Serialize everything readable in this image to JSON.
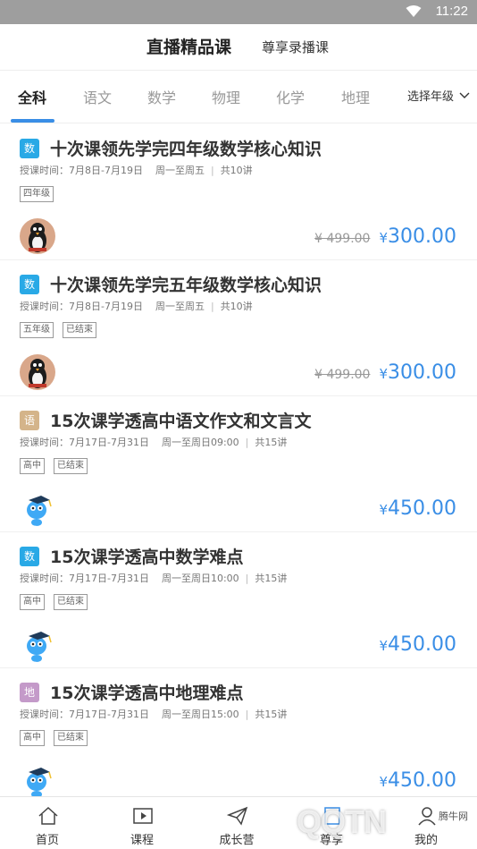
{
  "status": {
    "time": "11:22"
  },
  "header": {
    "title_live": "直播精品课",
    "title_recorded": "尊享录播课"
  },
  "tabs": {
    "items": [
      "全科",
      "语文",
      "数学",
      "物理",
      "化学",
      "地理"
    ],
    "active_index": 0,
    "grade_select_label": "选择年级"
  },
  "courses": [
    {
      "subject": "数",
      "subject_color": "#29a9e6",
      "title": "十次课领先学完四年级数学核心知识",
      "time": "授课时间：7月8日-7月19日",
      "days": "周一至周五",
      "count": "共10讲",
      "tags": [
        "四年级"
      ],
      "old_price": "¥ 499.00",
      "price_symbol": "¥",
      "price": "300.00",
      "avatar": "penguin-avatar"
    },
    {
      "subject": "数",
      "subject_color": "#29a9e6",
      "title": "十次课领先学完五年级数学核心知识",
      "time": "授课时间：7月8日-7月19日",
      "days": "周一至周五",
      "count": "共10讲",
      "tags": [
        "五年级",
        "已结束"
      ],
      "old_price": "¥ 499.00",
      "price_symbol": "¥",
      "price": "300.00",
      "avatar": "penguin-avatar"
    },
    {
      "subject": "语",
      "subject_color": "#d4b48a",
      "title": "15次课学透高中语文作文和文言文",
      "time": "授课时间：7月17日-7月31日",
      "days": "周一至周日09:00",
      "count": "共15讲",
      "tags": [
        "高中",
        "已结束"
      ],
      "old_price": "",
      "price_symbol": "¥",
      "price": "450.00",
      "avatar": "mascot-avatar"
    },
    {
      "subject": "数",
      "subject_color": "#29a9e6",
      "title": "15次课学透高中数学难点",
      "time": "授课时间：7月17日-7月31日",
      "days": "周一至周日10:00",
      "count": "共15讲",
      "tags": [
        "高中",
        "已结束"
      ],
      "old_price": "",
      "price_symbol": "¥",
      "price": "450.00",
      "avatar": "mascot-avatar"
    },
    {
      "subject": "地",
      "subject_color": "#c49ac9",
      "title": "15次课学透高中地理难点",
      "time": "授课时间：7月17日-7月31日",
      "days": "周一至周日15:00",
      "count": "共15讲",
      "tags": [
        "高中",
        "已结束"
      ],
      "old_price": "",
      "price_symbol": "¥",
      "price": "450.00",
      "avatar": "mascot-avatar"
    }
  ],
  "tabbar": {
    "items": [
      {
        "label": "首页",
        "icon": "home-icon"
      },
      {
        "label": "课程",
        "icon": "play-icon"
      },
      {
        "label": "成长营",
        "icon": "send-icon"
      },
      {
        "label": "尊享",
        "icon": "book-icon"
      },
      {
        "label": "我的",
        "icon": "user-icon"
      }
    ]
  },
  "watermark": {
    "logo": "QQTN",
    "site": "腾牛网"
  }
}
